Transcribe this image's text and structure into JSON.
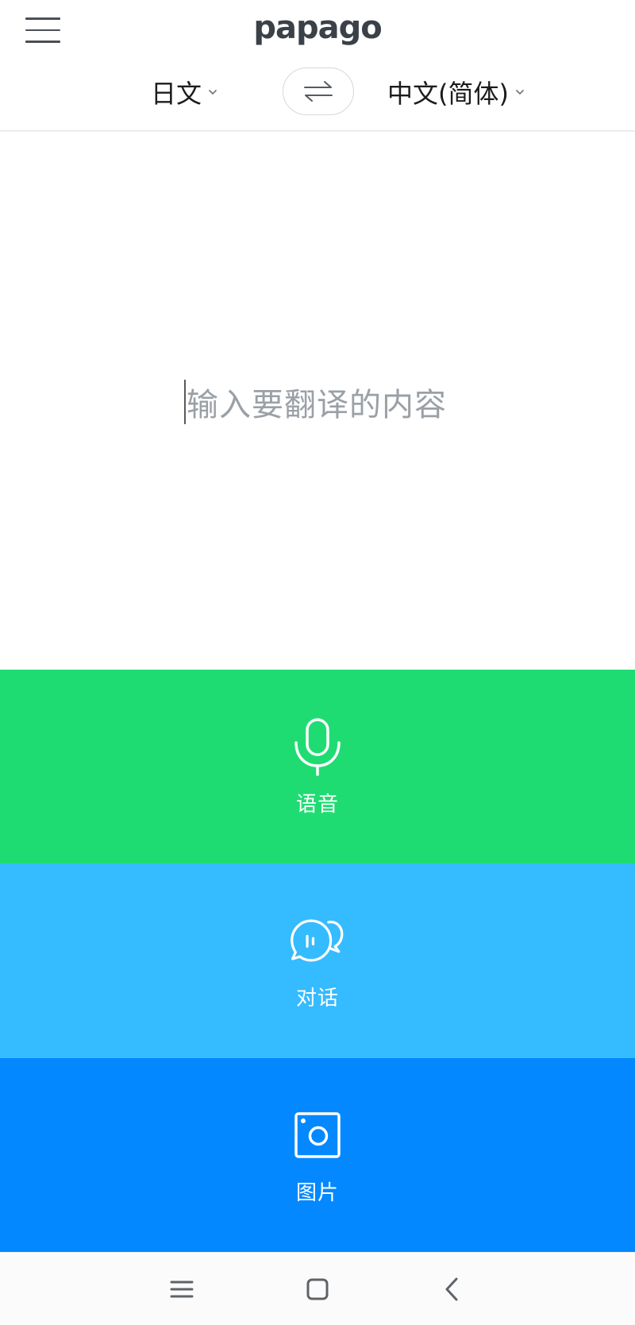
{
  "app": {
    "logo": "papago"
  },
  "header": {
    "source_language": "日文",
    "target_language": "中文(简体)",
    "menu_icon": "hamburger-menu-icon",
    "swap_icon": "swap-arrows-icon"
  },
  "input": {
    "placeholder": "输入要翻译的内容"
  },
  "actions": {
    "voice": {
      "label": "语音",
      "icon": "microphone-icon",
      "color": "#1fdc72"
    },
    "conversation": {
      "label": "对话",
      "icon": "chat-bubbles-icon",
      "color": "#35bbff"
    },
    "image": {
      "label": "图片",
      "icon": "camera-icon",
      "color": "#0388ff"
    }
  },
  "system_nav": {
    "recent_icon": "recent-apps-icon",
    "home_icon": "home-icon",
    "back_icon": "back-icon"
  }
}
